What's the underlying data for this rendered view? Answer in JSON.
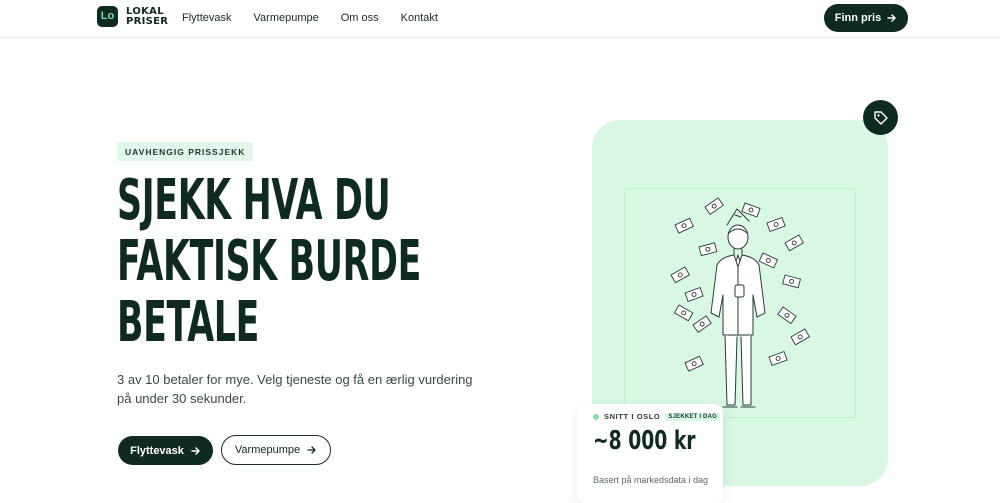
{
  "header": {
    "logo_line1": "LOKAL",
    "logo_line2": "PRISER",
    "logo_mark": "Lo",
    "nav": [
      "Flyttevask",
      "Varmepumpe",
      "Om oss",
      "Kontakt"
    ],
    "cta_label": "Finn pris"
  },
  "hero": {
    "badge": "UAVHENGIG PRISSJEKK",
    "headline": [
      "SJEKK HVA DU",
      "FAKTISK BURDE",
      "BETALE"
    ],
    "subtitle_line1": "3 av 10 betaler for mye. Velg tjeneste og få en ærlig vurdering",
    "subtitle_line2": "på under 30 sekunder.",
    "primary_button": "Flyttevask",
    "secondary_button": "Varmepumpe"
  },
  "price_card": {
    "label": "SNITT I OSLO",
    "pill": "SJEKKET I DAG",
    "value": "~8 000 kr",
    "note": "Basert på markedsdata i dag"
  },
  "icons": {
    "arrow": "arrow-right-icon",
    "tag": "price-tag-icon"
  },
  "colors": {
    "brand_dark": "#0f2a21",
    "accent_mint": "#d9f8e4",
    "accent_green": "#7fe0a9"
  }
}
